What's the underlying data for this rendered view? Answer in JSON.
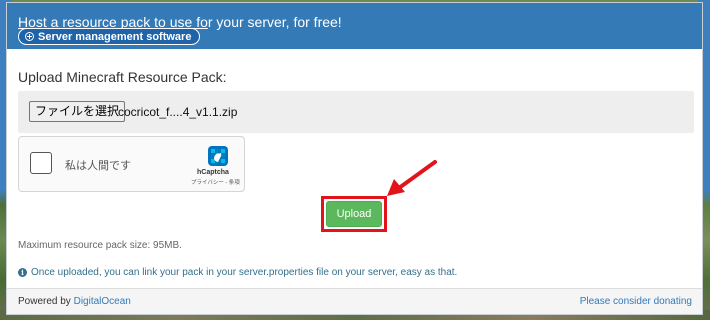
{
  "header": {
    "title_link": "Host a resource pack to use fo",
    "title_rest": "r your server, for free!",
    "server_button_label": "Server management software"
  },
  "main": {
    "heading": "Upload Minecraft Resource Pack:",
    "file_button_label": "ファイルを選択",
    "file_name": "cocricot_f....4_v1.1.zip",
    "captcha": {
      "label": "私は人間です",
      "brand": "hCaptcha",
      "links": "プライバシー - 条項"
    },
    "upload_button_label": "Upload",
    "max_size_note": "Maximum resource pack size: 95MB.",
    "info_note": "Once uploaded, you can link your pack in your server.properties file on your server, easy as that."
  },
  "footer": {
    "powered_prefix": "Powered by ",
    "powered_link": "DigitalOcean",
    "donate_link": "Please consider donating"
  },
  "colors": {
    "header_bg": "#337ab7",
    "upload_green": "#5cb85c",
    "highlight_red": "#e2131b",
    "info_blue": "#31708f"
  }
}
